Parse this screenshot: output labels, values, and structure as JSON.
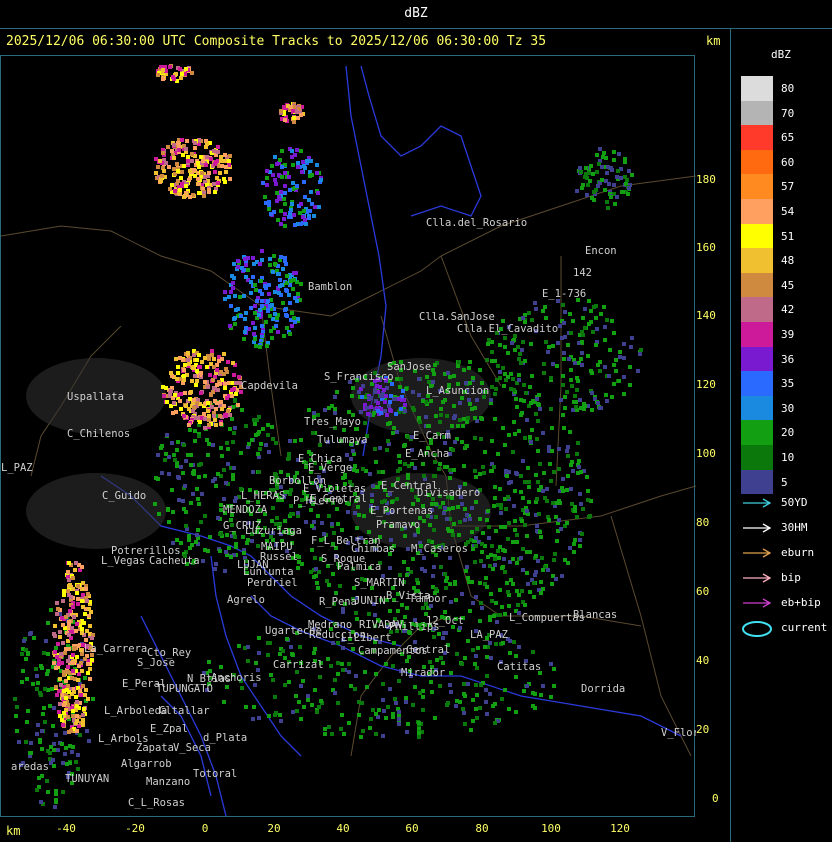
{
  "header": {
    "title": "dBZ"
  },
  "subtitle": "2025/12/06 06:30:00 UTC Composite Tracks to 2025/12/06 06:30:00 Tz 35",
  "km_top": "km",
  "km_bottom": "km",
  "legend": {
    "title": "dBZ",
    "scale": [
      {
        "label": "80",
        "color": "#dcdcdc"
      },
      {
        "label": "70",
        "color": "#b4b4b4"
      },
      {
        "label": "65",
        "color": "#ff3a2a"
      },
      {
        "label": "60",
        "color": "#ff6a10"
      },
      {
        "label": "57",
        "color": "#ff8a20"
      },
      {
        "label": "54",
        "color": "#ffa060"
      },
      {
        "label": "51",
        "color": "#ffff00"
      },
      {
        "label": "48",
        "color": "#f0c030"
      },
      {
        "label": "45",
        "color": "#d08a40"
      },
      {
        "label": "42",
        "color": "#c06a8a"
      },
      {
        "label": "39",
        "color": "#cc1a9a"
      },
      {
        "label": "36",
        "color": "#7a1ad0"
      },
      {
        "label": "35",
        "color": "#2a6aff"
      },
      {
        "label": "30",
        "color": "#1a8ae0"
      },
      {
        "label": "20",
        "color": "#12a012"
      },
      {
        "label": "10",
        "color": "#0a780a"
      },
      {
        "label": "5",
        "color": "#404090"
      }
    ],
    "tracks": [
      {
        "label": "50YD",
        "color": "#40d0e0"
      },
      {
        "label": "30HM",
        "color": "#ffffff"
      },
      {
        "label": "eburn",
        "color": "#e0a050"
      },
      {
        "label": "bip",
        "color": "#ffb0c0"
      },
      {
        "label": "eb+bip",
        "color": "#d040d0"
      },
      {
        "label": "current",
        "color": "#40e0f0"
      }
    ]
  },
  "axes": {
    "y_ticks": [
      "180",
      "160",
      "140",
      "120",
      "100",
      "80",
      "60",
      "40",
      "20",
      "0"
    ],
    "x_ticks": [
      "-40",
      "-20",
      "0",
      "20",
      "40",
      "60",
      "80",
      "100",
      "120"
    ]
  },
  "places": [
    "Clla.del_Rosario",
    "Encon",
    "E_1-736",
    "142",
    "Clla.SanJose",
    "Clla.El_Cavadito",
    "Bamblon",
    "Uspallata",
    "Capdevila",
    "S_Francisco",
    "SanJose",
    "L_Asuncion",
    "C_Chilenos",
    "Tres_Mayo",
    "Tulumaya",
    "E_Carm",
    "E_Ancha",
    "E_Chica",
    "E_Verge",
    "Borbollon",
    "E_Violetas",
    "E_Central",
    "Divisadero",
    "C_Guido",
    "L_HERAS",
    "E_Central",
    "P_Hierro",
    "MENDOZA",
    "E_Portenas",
    "G_CRUZ",
    "Luzuriaga",
    "Pramavo",
    "F_L_Beltran",
    "M_Caseros",
    "Potrerillos",
    "MAIPU",
    "Russel",
    "Chimbas",
    "Cacheuta",
    "L_Vegas",
    "LUJAN",
    "Lunlunta",
    "S_Roque",
    "Palmica",
    "Perdriel",
    "S_MARTIN",
    "Agrelo",
    "R_Pena",
    "JUNIN",
    "B_Vista",
    "Tambor",
    "Ugarteche",
    "Medrano",
    "RIVADAV",
    "Phillips",
    "12_Oct",
    "L_Compuertas",
    "Blancas",
    "Reduccion",
    "L_Libert",
    "Campamentos",
    "Central",
    "LA_PAZ",
    "La_Carrera",
    "S_Jose",
    "Cto_Rey",
    "Carrizal",
    "Catitas",
    "Anchoris",
    "Mirador",
    "E_Peral",
    "TUPUNGATO",
    "N_Btias",
    "Dorrida",
    "L_Arboleda",
    "Gltallar",
    "E_Zpal",
    "L_Arbols",
    "d_Plata",
    "Zapata",
    "Algarrob",
    "V_Seca",
    "Totoral",
    "TUNUYAN",
    "Manzano",
    "C_L_Rosas",
    "V_Flores",
    "L_PAZ",
    "aredas"
  ]
}
